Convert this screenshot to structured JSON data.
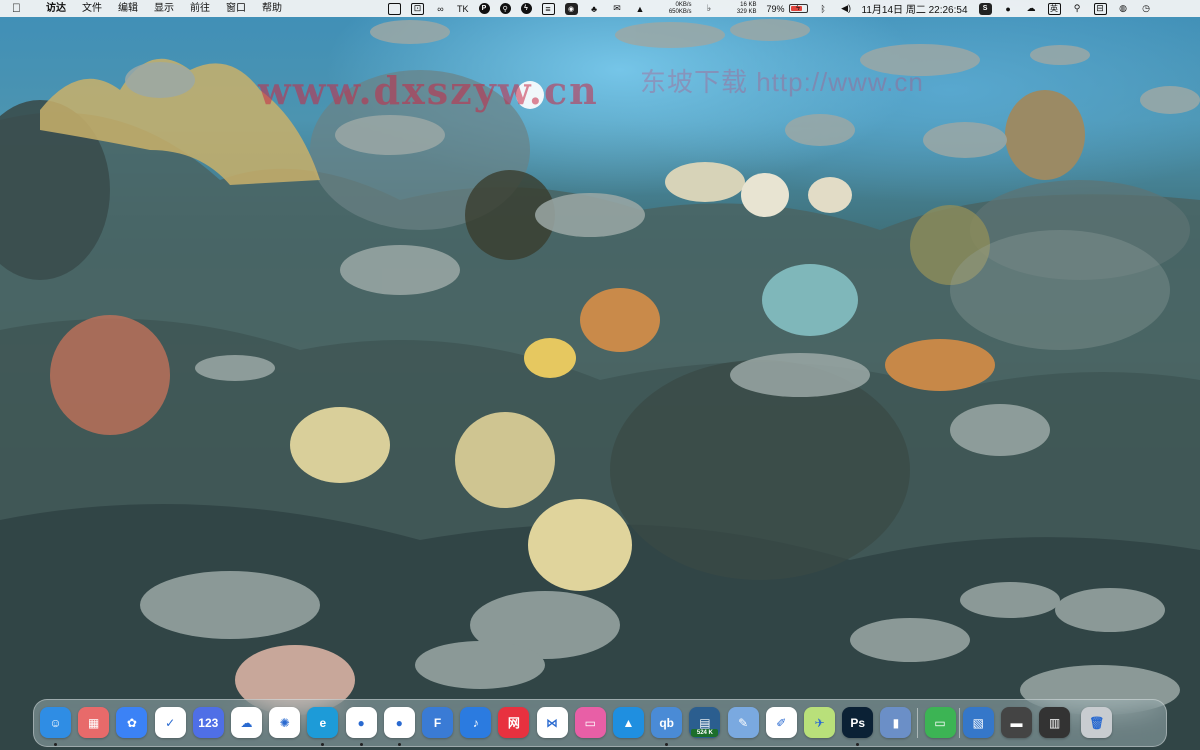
{
  "menubar": {
    "apple_icon": "apple-icon",
    "items": [
      "访达",
      "文件",
      "编辑",
      "显示",
      "前往",
      "窗口",
      "帮助"
    ],
    "status": {
      "tk_label": "TK",
      "net_up": "0KB/s",
      "net_down": "650KB/s",
      "mem_top": "16 KB",
      "mem_bottom": "329 KB",
      "battery_percent": "79%",
      "battery_level": 0.79,
      "battery_color": "#e0443c",
      "clock": "11月14日 周二 22:26:54",
      "ime": "英"
    }
  },
  "watermark": {
    "primary": "www.dxszyw.cn",
    "secondary": "东坡下载 http://www.cn"
  },
  "dock": {
    "apps": [
      {
        "name": "finder",
        "icon": "finder-icon",
        "label": "☺",
        "color": "#2f8de4"
      },
      {
        "name": "launchpad",
        "icon": "launchpad-icon",
        "label": "▦",
        "color": "#e86a6a"
      },
      {
        "name": "tuzhi",
        "icon": "cat-icon",
        "label": "✿",
        "color": "#3b82f6"
      },
      {
        "name": "todo",
        "icon": "checkmark-icon",
        "label": "✓",
        "color": "#ffffff"
      },
      {
        "name": "123pan",
        "icon": "123-icon",
        "label": "123",
        "color": "#4f6fe6"
      },
      {
        "name": "baidu-netdisk",
        "icon": "cloud-icon",
        "label": "☁",
        "color": "#ffffff"
      },
      {
        "name": "photos-helper",
        "icon": "pinwheel-icon",
        "label": "✺",
        "color": "#ffffff"
      },
      {
        "name": "edge",
        "icon": "edge-icon",
        "label": "e",
        "color": "#1d9bd8"
      },
      {
        "name": "qq",
        "icon": "penguin-icon",
        "label": "●",
        "color": "#ffffff"
      },
      {
        "name": "wechat",
        "icon": "wechat-icon",
        "label": "●",
        "color": "#ffffff"
      },
      {
        "name": "finder-tool",
        "icon": "f-icon",
        "label": "F",
        "color": "#3a7bd5"
      },
      {
        "name": "music",
        "icon": "music-icon",
        "label": "♪",
        "color": "#2b7be0"
      },
      {
        "name": "netease-music",
        "icon": "netease-icon",
        "label": "网",
        "color": "#e8313f"
      },
      {
        "name": "kdocs",
        "icon": "bowtie-icon",
        "label": "⋈",
        "color": "#ffffff"
      },
      {
        "name": "cleaner",
        "icon": "laptop-icon",
        "label": "▭",
        "color": "#e85fa6"
      },
      {
        "name": "mountain-app",
        "icon": "mountain-icon",
        "label": "▲",
        "color": "#1f8fe0"
      },
      {
        "name": "qbittorrent",
        "icon": "qb-icon",
        "label": "qb",
        "color": "#4a8bd6"
      },
      {
        "name": "activity-monitor",
        "icon": "monitor-icon",
        "label": "▤",
        "color": "#2b5e8f",
        "badge": "524 K"
      },
      {
        "name": "pencil-tool",
        "icon": "pencil-icon",
        "label": "✎",
        "color": "#7aa9e0"
      },
      {
        "name": "draw-tool",
        "icon": "sketch-icon",
        "label": "✐",
        "color": "#ffffff"
      },
      {
        "name": "stamp-app",
        "icon": "stamp-icon",
        "label": "✈",
        "color": "#b9e07a"
      },
      {
        "name": "photoshop",
        "icon": "photoshop-icon",
        "label": "Ps",
        "color": "#0b2135"
      },
      {
        "name": "preview",
        "icon": "preview-icon",
        "label": "▮",
        "color": "#6b8fc7"
      },
      {
        "name": "notes-green",
        "icon": "note-icon",
        "label": "▭",
        "color": "#3cb454"
      },
      {
        "name": "wallpaper-folder",
        "icon": "folder-icon",
        "label": "▧",
        "color": "#3577c9"
      },
      {
        "name": "downloads",
        "icon": "downloads-icon",
        "label": "▬",
        "color": "#444444"
      },
      {
        "name": "screens",
        "icon": "screens-icon",
        "label": "▥",
        "color": "#333333"
      },
      {
        "name": "trash",
        "icon": "trash-icon",
        "label": "🗑",
        "color": "#c8ccd0"
      }
    ]
  }
}
